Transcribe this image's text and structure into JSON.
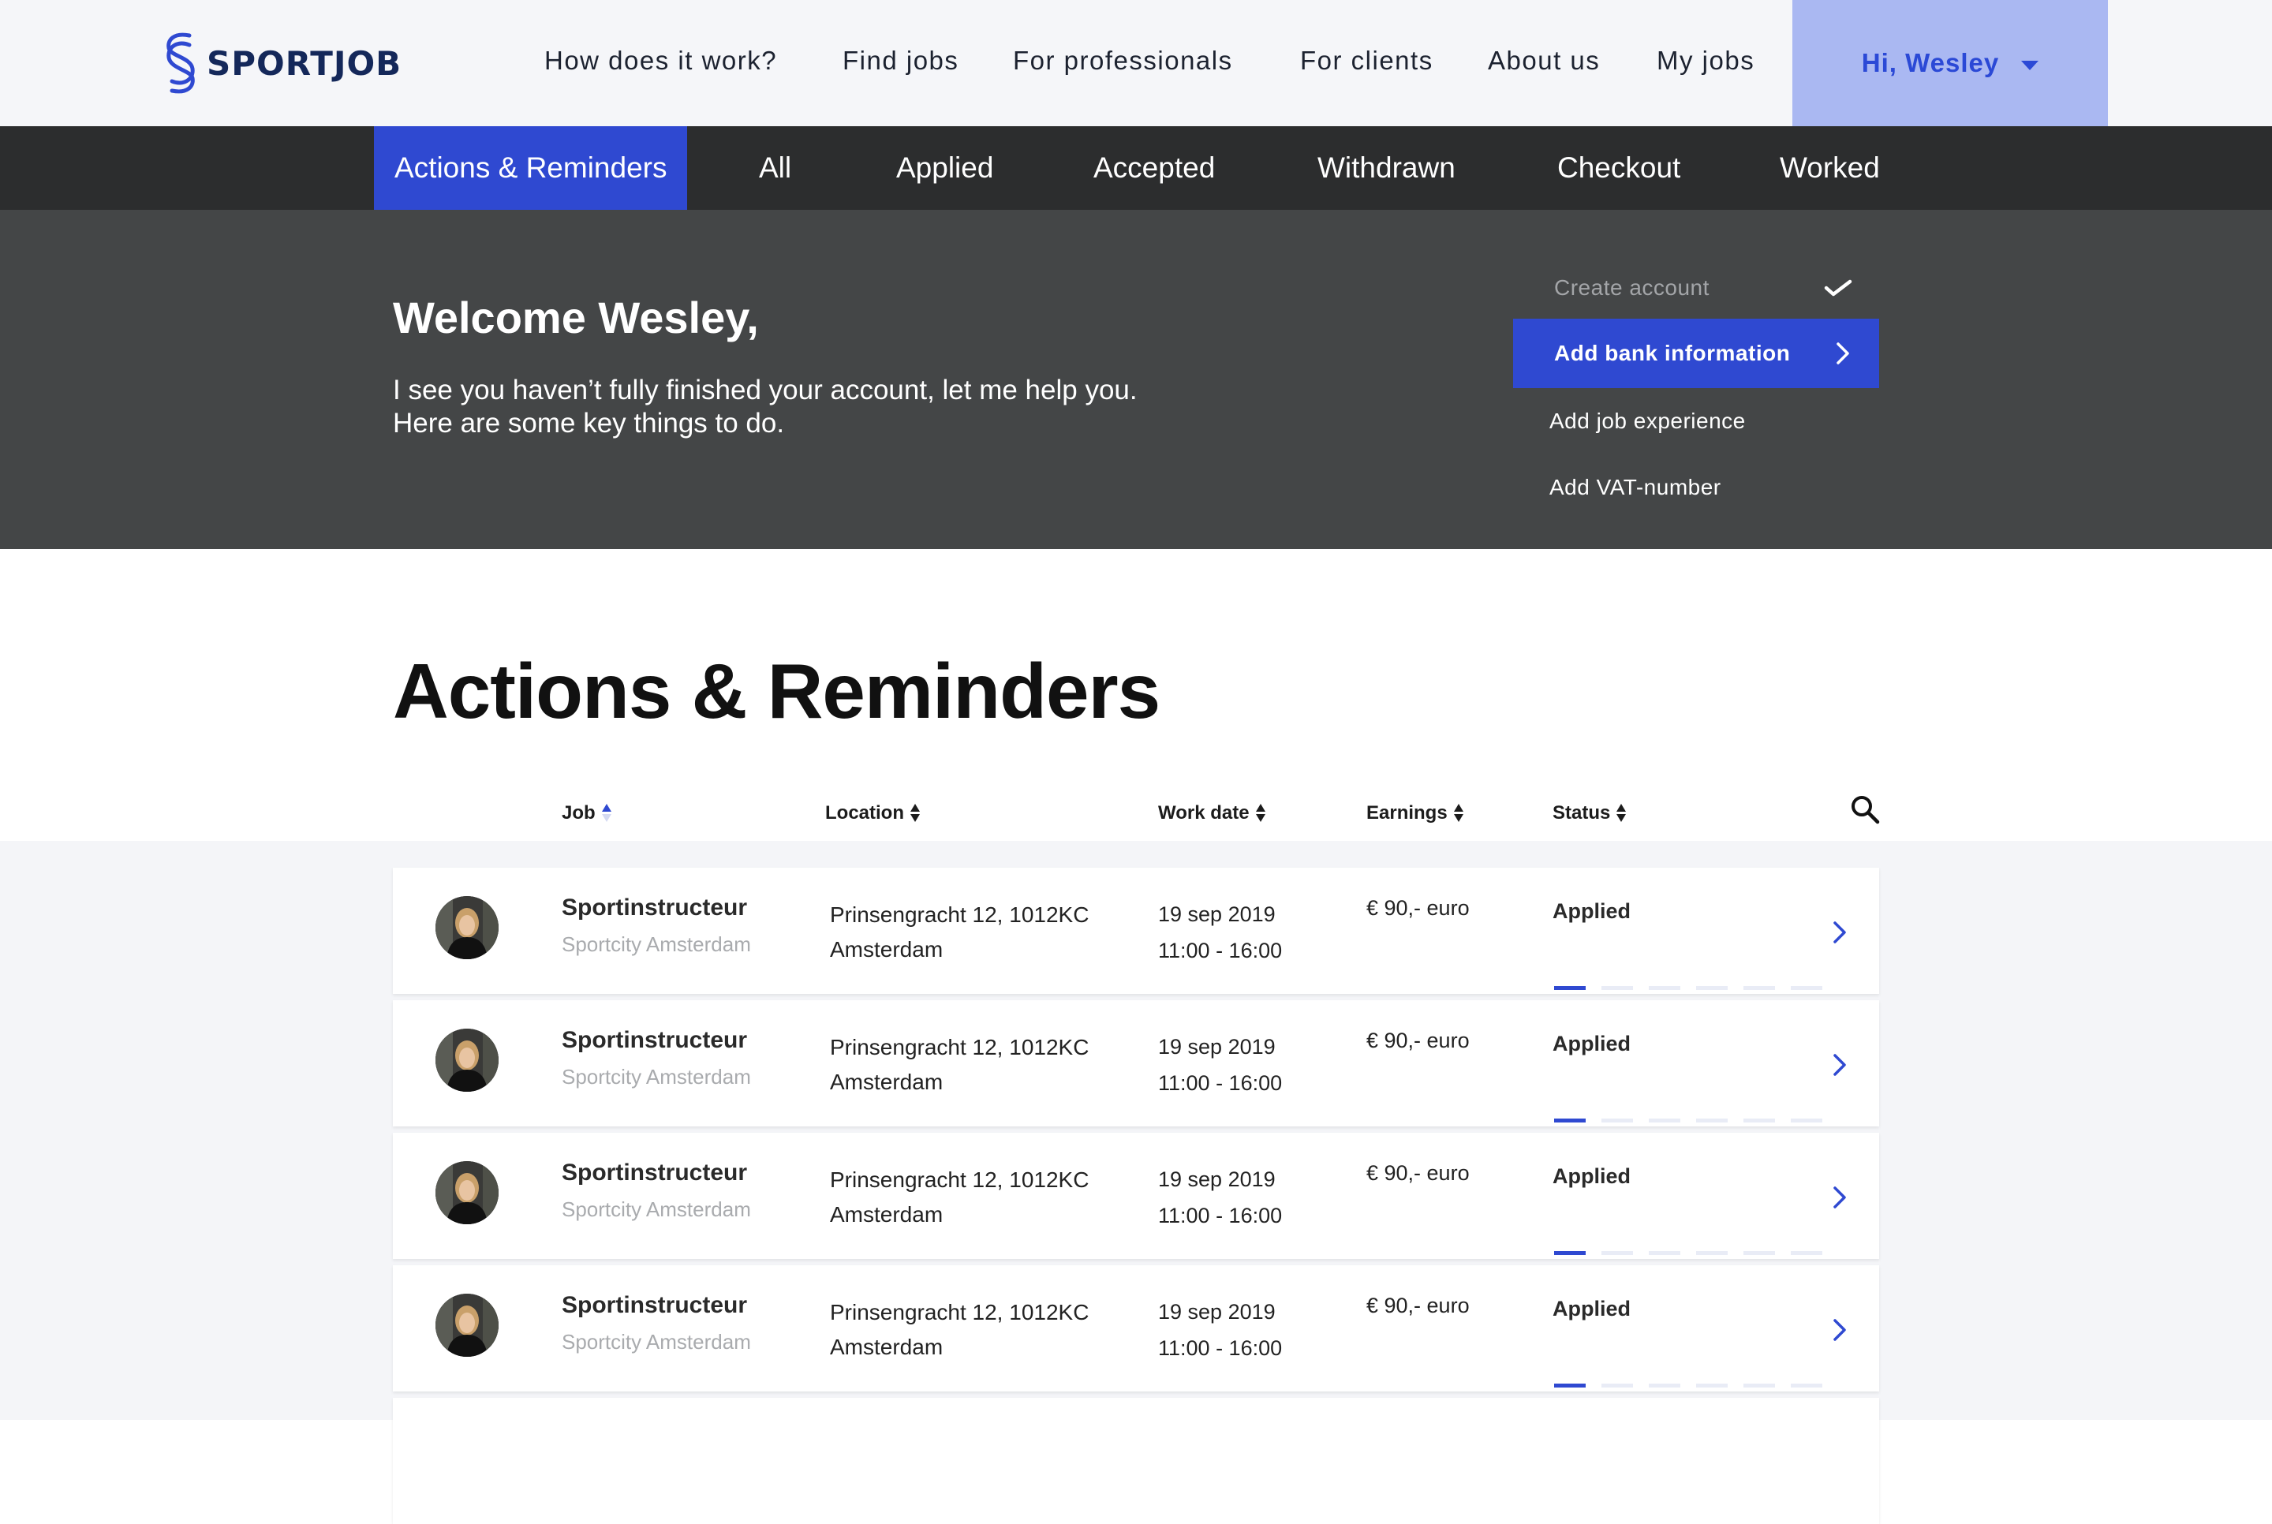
{
  "app": {
    "brand": "SPORTJOB",
    "accent_color": "#2f49d1",
    "logo_icon": "sportjob-s-logo-icon"
  },
  "nav": {
    "links": [
      {
        "label": "How does it work?"
      },
      {
        "label": "Find jobs"
      },
      {
        "label": "For professionals"
      },
      {
        "label": "For clients"
      },
      {
        "label": "About us"
      },
      {
        "label": "My jobs"
      }
    ],
    "user_greeting": "Hi, Wesley"
  },
  "tabs": [
    {
      "label": "Actions & Reminders",
      "active": true
    },
    {
      "label": "All"
    },
    {
      "label": "Applied"
    },
    {
      "label": "Accepted"
    },
    {
      "label": "Withdrawn"
    },
    {
      "label": "Checkout"
    },
    {
      "label": "Worked"
    }
  ],
  "banner": {
    "title": "Welcome Wesley,",
    "line1": "I see you haven’t fully finished your account, let me help you.",
    "line2": "Here are some key things to do.",
    "checklist": [
      {
        "label": "Create account",
        "state": "done"
      },
      {
        "label": "Add bank information",
        "state": "current"
      },
      {
        "label": "Add job experience",
        "state": "todo"
      },
      {
        "label": "Add VAT-number",
        "state": "todo"
      }
    ]
  },
  "page": {
    "heading": "Actions & Reminders"
  },
  "table": {
    "columns": [
      {
        "label": "Job",
        "sort": "asc"
      },
      {
        "label": "Location",
        "sort": "none"
      },
      {
        "label": "Work date",
        "sort": "none"
      },
      {
        "label": "Earnings",
        "sort": "none"
      },
      {
        "label": "Status",
        "sort": "none"
      }
    ],
    "rows": [
      {
        "title": "Sportinstructeur",
        "company": "Sportcity Amsterdam",
        "address": "Prinsengracht 12, 1012KC",
        "city": "Amsterdam",
        "date": "19 sep 2019",
        "time": "11:00 - 16:00",
        "earnings": "€ 90,- euro",
        "status": "Applied",
        "progress_steps": 6,
        "progress_done": 1
      },
      {
        "title": "Sportinstructeur",
        "company": "Sportcity Amsterdam",
        "address": "Prinsengracht 12, 1012KC",
        "city": "Amsterdam",
        "date": "19 sep 2019",
        "time": "11:00 - 16:00",
        "earnings": "€ 90,- euro",
        "status": "Applied",
        "progress_steps": 6,
        "progress_done": 1
      },
      {
        "title": "Sportinstructeur",
        "company": "Sportcity Amsterdam",
        "address": "Prinsengracht 12, 1012KC",
        "city": "Amsterdam",
        "date": "19 sep 2019",
        "time": "11:00 - 16:00",
        "earnings": "€ 90,- euro",
        "status": "Applied",
        "progress_steps": 6,
        "progress_done": 1
      },
      {
        "title": "Sportinstructeur",
        "company": "Sportcity Amsterdam",
        "address": "Prinsengracht 12, 1012KC",
        "city": "Amsterdam",
        "date": "19 sep 2019",
        "time": "11:00 - 16:00",
        "earnings": "€ 90,- euro",
        "status": "Applied",
        "progress_steps": 6,
        "progress_done": 1
      }
    ]
  }
}
